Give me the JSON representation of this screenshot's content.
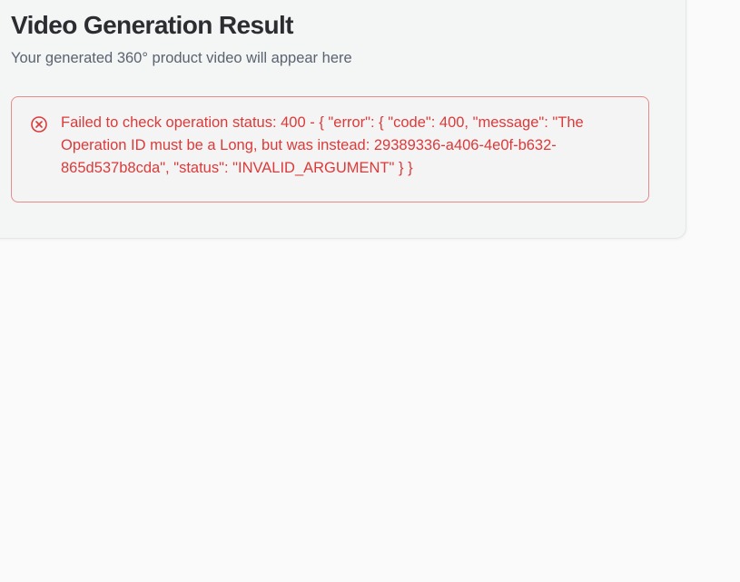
{
  "result": {
    "title": "Video Generation Result",
    "subtitle": "Your generated 360° product video will appear here"
  },
  "error": {
    "icon": "x-circle-icon",
    "message": "Failed to check operation status: 400 - { \"error\": { \"code\": 400, \"message\": \"The Operation ID must be a Long, but was instead: 29389336-a406-4e0f-b632-865d537b8cda\", \"status\": \"INVALID_ARGUMENT\" } }",
    "color": "#dc3a3a",
    "border_color": "#e88b8b"
  },
  "colors": {
    "page_background": "#fafafa",
    "card_background": "#f4f5f5",
    "title": "#2b2d31",
    "subtitle": "#5b6370"
  }
}
